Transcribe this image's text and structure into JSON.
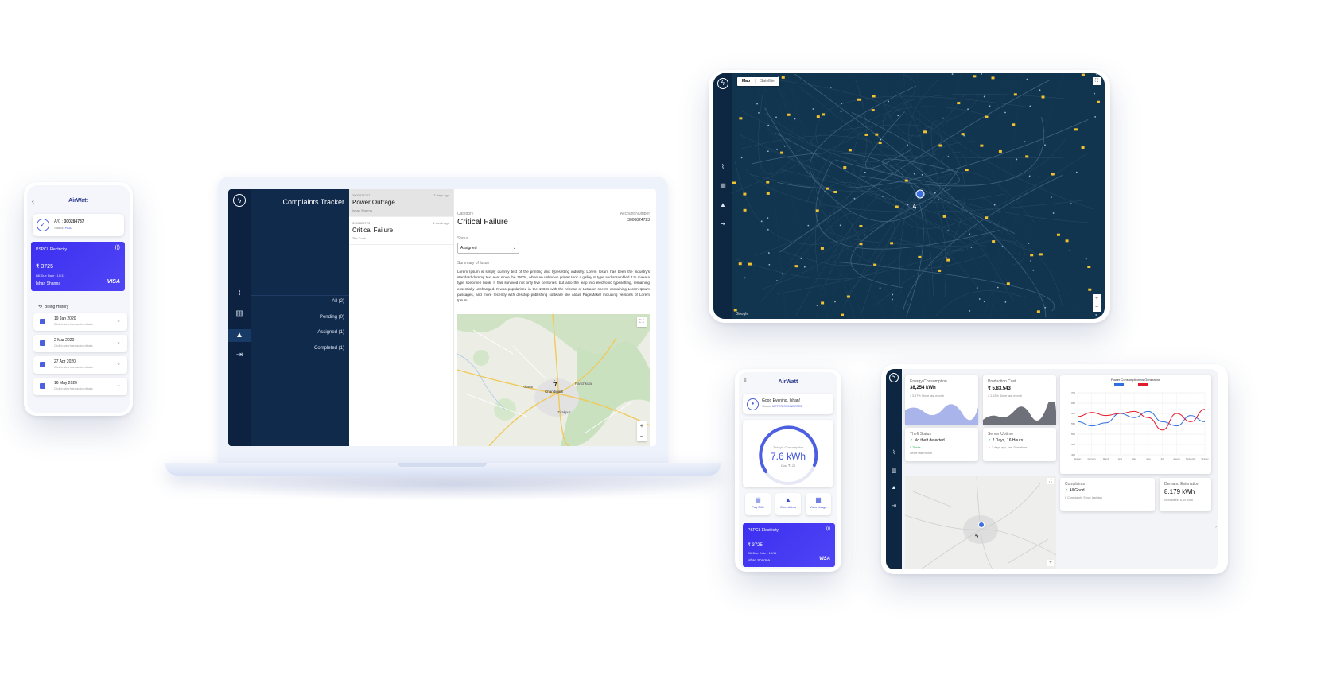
{
  "phone_left": {
    "app_title": "AirWatt",
    "account_label": "A/C :",
    "account_number": "300284787",
    "status_label": "Status:",
    "status_value": "PAID",
    "card_provider": "PSPCL Electricity",
    "card_amount": "₹ 3725",
    "card_due": "Bill Due Date : 10/11",
    "card_holder": "Ishan Sharma",
    "card_brand": "VISA",
    "billing_history_title": "Billing History",
    "billing_hint": "Click to view transaction details",
    "bills": [
      {
        "date": "19 Jan 2020"
      },
      {
        "date": "2 Mar 2020"
      },
      {
        "date": "27 Apr 2020"
      },
      {
        "date": "16 May 2020"
      }
    ]
  },
  "laptop": {
    "panel_title": "Complaints Tracker",
    "filters": [
      "All (2)",
      "Pending (0)",
      "Assigned (1)",
      "Completed (1)"
    ],
    "complaints": [
      {
        "id": "3000824787",
        "time": "3 days ago",
        "title": "Power Outrage",
        "name": "Ishan Sharma"
      },
      {
        "id": "3000824723",
        "time": "1 week ago",
        "title": "Critical Failure",
        "name": "Tim Cook"
      }
    ],
    "detail": {
      "category_label": "Category",
      "category_value": "Critical Failure",
      "account_label": "Account Number",
      "account_value": "3000824723",
      "status_label": "Status",
      "status_value": "Assigned",
      "summary_label": "Summary of Issue",
      "summary_text": "Lorem Ipsum is simply dummy text of the printing and typesetting industry. Lorem Ipsum has been the industry's standard dummy text ever since the 1500s, when an unknown printer took a galley of type and scrambled it to make a type specimen book. It has survived not only five centuries, but also the leap into electronic typesetting, remaining essentially unchanged. It was popularised in the 1960s with the release of Letraset sheets containing Lorem Ipsum passages, and more recently with desktop publishing software like Aldus PageMaker including versions of Lorem Ipsum."
    },
    "map_labels": [
      "Kharar",
      "Chandigarh",
      "Zirakpur",
      "Panchkula"
    ]
  },
  "tablet_map": {
    "tab_map": "Map",
    "tab_satellite": "Satellite",
    "zoom_in": "+",
    "zoom_out": "−",
    "google": "Google"
  },
  "phone_mid": {
    "app_title": "AirWatt",
    "greeting": "Good Evening, Ishan!",
    "status_label": "Status:",
    "status_value": "METER CONNECTED",
    "today_label": "Today's Consumption",
    "today_value": "7.6 kWh",
    "today_cost": "Cost ₹120",
    "actions": [
      "Pay Bills",
      "Complaints",
      "View Usage"
    ],
    "card_provider": "PSPCL Electricity",
    "card_amount": "₹ 3725",
    "card_due": "Bill Due Date : 10/11",
    "card_holder": "Ishan Sharma",
    "card_brand": "VISA"
  },
  "dashboard": {
    "energy_label": "Energy Consumption",
    "energy_value": "38,254 kWh",
    "energy_delta": "3.47% Since last month",
    "cost_label": "Production Cost",
    "cost_value": "₹ 5,83,543",
    "cost_delta": "1.02% Since last month",
    "theft_label": "Theft Status",
    "theft_value": "No theft detected",
    "theft_sub": "0 Thefts",
    "theft_note": "Since last month",
    "uptime_label": "Server Uptime",
    "uptime_value": "2 Days, 16 Hours",
    "uptime_sub": "3 days ago, last Downtime",
    "complaints_label": "Complaints",
    "complaints_value": "All Good",
    "complaints_sub": "0 Complaints Since last day",
    "demand_label": "Demand Estimation",
    "demand_value": "8.179 kWh",
    "demand_sub": "Next week: 8.10 kWh",
    "chart_title": "Power Consumption vs Generation"
  },
  "colors": {
    "navy": "#102a4c",
    "accent_blue": "#3d2ff0",
    "map_dark": "#11344f",
    "chart_red": "#e21b2c",
    "chart_blue": "#2f6fe0"
  },
  "chart_data": {
    "type": "line",
    "title": "Power Consumption vs Generation",
    "categories": [
      "January",
      "February",
      "March",
      "April",
      "May",
      "June",
      "July",
      "August",
      "September",
      "October"
    ],
    "series": [
      {
        "values": [
          560,
          540,
          555,
          600,
          580,
          610,
          560,
          540,
          590,
          560
        ]
      },
      {
        "values": [
          585,
          605,
          590,
          600,
          610,
          580,
          520,
          600,
          560,
          620
        ]
      }
    ],
    "ylim": [
      400,
      700
    ]
  }
}
